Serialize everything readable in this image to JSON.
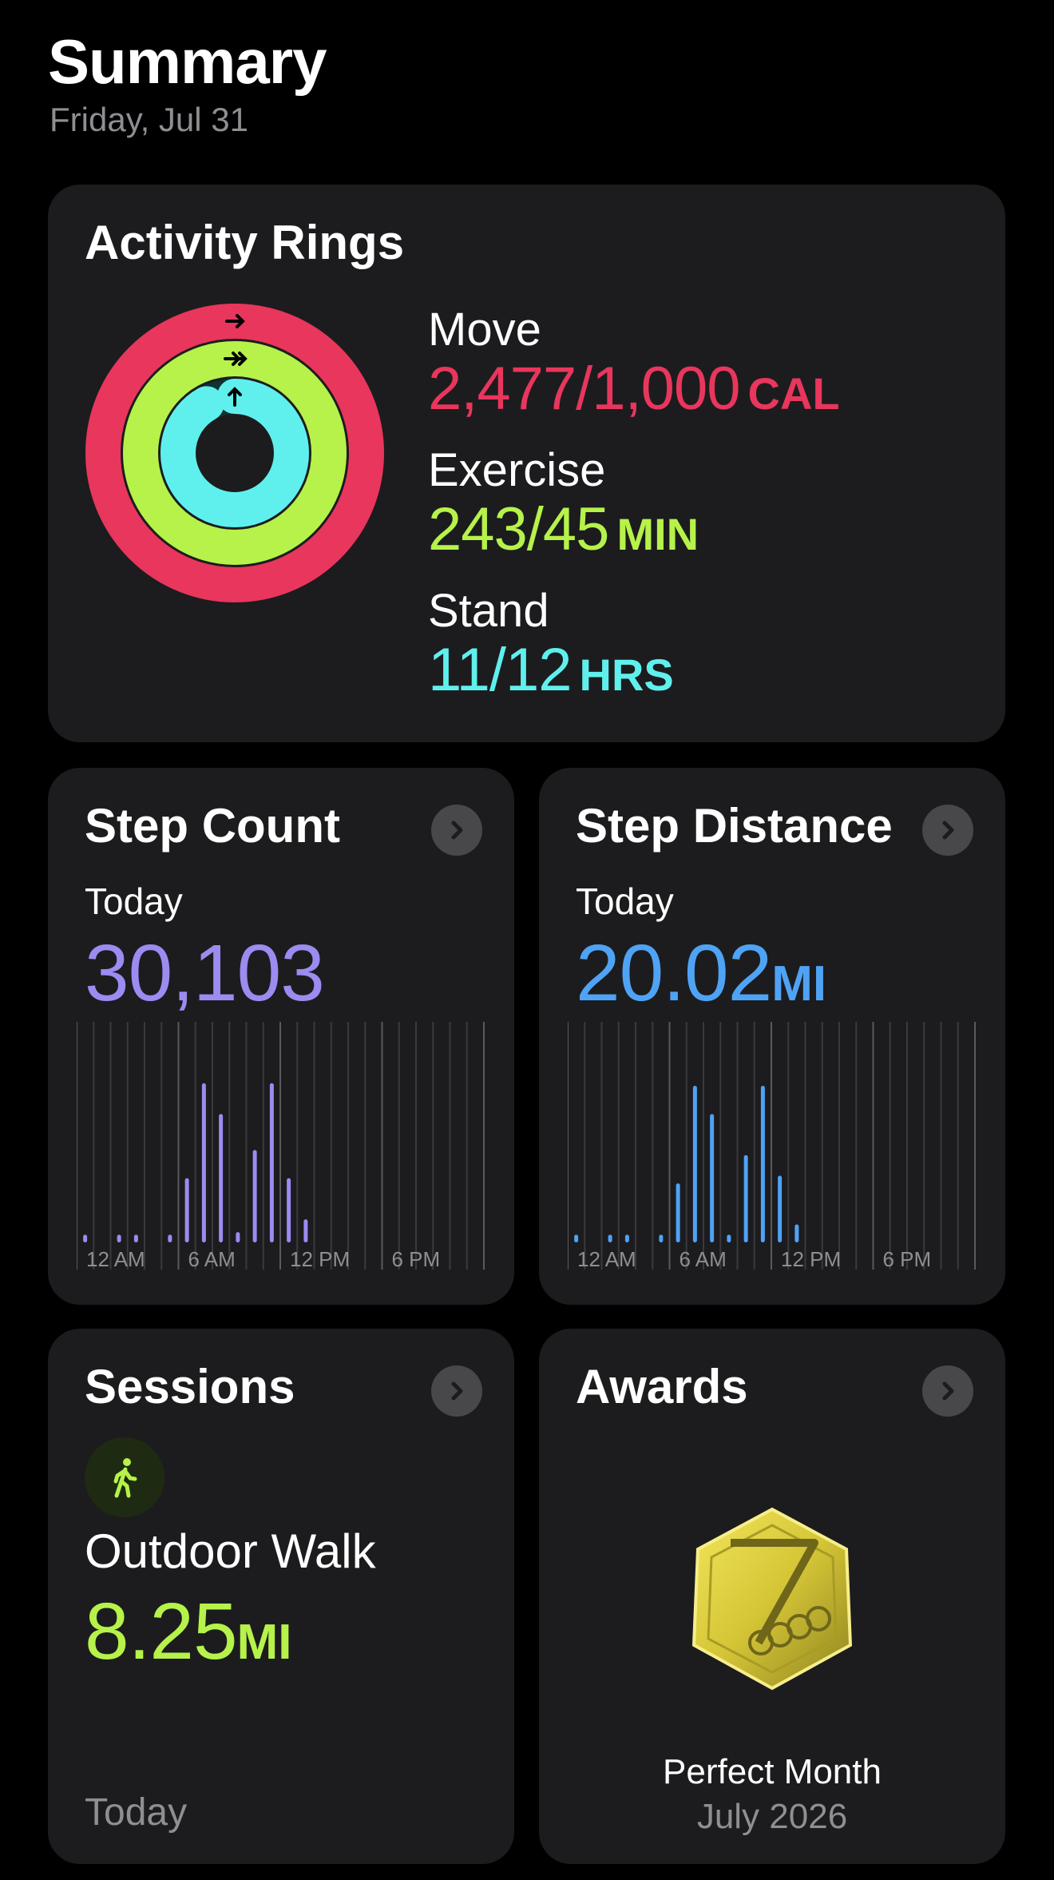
{
  "header": {
    "title": "Summary",
    "date": "Friday, Jul 31"
  },
  "colors": {
    "move": "#e8365d",
    "exercise": "#b6f24a",
    "stand": "#5ff0ee",
    "steps": "#9a8cf0",
    "distance": "#4fa3f4"
  },
  "activity": {
    "title": "Activity Rings",
    "move": {
      "label": "Move",
      "value": "2,477/1,000",
      "unit": "CAL",
      "fraction": 2.477
    },
    "exercise": {
      "label": "Exercise",
      "value": "243/45",
      "unit": "MIN",
      "fraction": 5.4
    },
    "stand": {
      "label": "Stand",
      "value": "11/12",
      "unit": "HRS",
      "fraction": 0.917
    }
  },
  "step_count": {
    "title": "Step Count",
    "today_label": "Today",
    "value": "30,103",
    "axis_labels": [
      "12 AM",
      "6 AM",
      "12 PM",
      "6 PM"
    ]
  },
  "step_distance": {
    "title": "Step Distance",
    "today_label": "Today",
    "value": "20.02",
    "unit": "MI",
    "axis_labels": [
      "12 AM",
      "6 AM",
      "12 PM",
      "6 PM"
    ]
  },
  "sessions": {
    "title": "Sessions",
    "icon": "walk-icon",
    "workout": "Outdoor Walk",
    "value": "8.25",
    "unit": "MI",
    "when": "Today"
  },
  "awards": {
    "title": "Awards",
    "medal_icon": "medal-icon",
    "name": "Perfect Month",
    "date": "July 2026"
  },
  "chart_data": [
    {
      "type": "bar",
      "categories": [
        "0",
        "1",
        "2",
        "3",
        "4",
        "5",
        "6",
        "7",
        "8",
        "9",
        "10",
        "11",
        "12",
        "13",
        "14",
        "15",
        "16",
        "17",
        "18",
        "19",
        "20",
        "21",
        "22",
        "23"
      ],
      "values": [
        0.03,
        0,
        0.03,
        0.03,
        0,
        0.03,
        0.25,
        0.62,
        0.5,
        0.04,
        0.36,
        0.62,
        0.25,
        0.09,
        0,
        0,
        0,
        0,
        0,
        0,
        0,
        0,
        0,
        0
      ],
      "xlabel": "",
      "ylabel": ""
    },
    {
      "type": "bar",
      "categories": [
        "0",
        "1",
        "2",
        "3",
        "4",
        "5",
        "6",
        "7",
        "8",
        "9",
        "10",
        "11",
        "12",
        "13",
        "14",
        "15",
        "16",
        "17",
        "18",
        "19",
        "20",
        "21",
        "22",
        "23"
      ],
      "values": [
        0.03,
        0,
        0.03,
        0.03,
        0,
        0.03,
        0.23,
        0.61,
        0.5,
        0.03,
        0.34,
        0.61,
        0.26,
        0.07,
        0,
        0,
        0,
        0,
        0,
        0,
        0,
        0,
        0,
        0
      ],
      "xlabel": "",
      "ylabel": ""
    }
  ]
}
